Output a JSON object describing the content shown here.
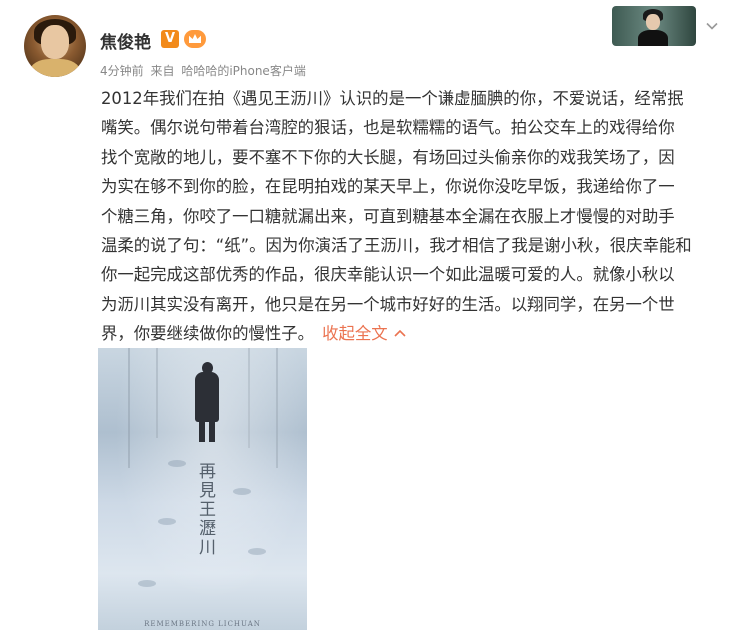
{
  "post": {
    "author": "焦俊艳",
    "vip_badge": "V",
    "time": "4分钟前",
    "source_prefix": "来自",
    "source": "哈哈哈的iPhone客户端",
    "lines": [
      "2012年我们在拍《遇见王沥川》认识的是一个谦虚腼腆的你，不爱说话，经常抿",
      "嘴笑。偶尔说句带着台湾腔的狠话，也是软糯糯的语气。拍公交车上的戏得给你",
      "找个宽敞的地儿，要不塞不下你的大长腿，有场回过头偷亲你的戏我笑场了，因",
      "为实在够不到你的脸，在昆明拍戏的某天早上，你说你没吃早饭，我递给你了一",
      "个糖三角，你咬了一口糖就漏出来，可直到糖基本全漏在衣服上才慢慢的对助手",
      "温柔的说了句：“纸”。因为你演活了王沥川，我才相信了我是谢小秋，很庆幸能和",
      "你一起完成这部优秀的作品，很庆幸能认识一个如此温暖可爱的人。就像小秋以",
      "为沥川其实没有离开，他只是在另一个城市好好的生活。以翔同学，在另一个世"
    ],
    "last_line": "界，你要继续做你的慢性子。",
    "collapse_label": "收起全文",
    "collapse_icon": "chevron-up-icon"
  },
  "poster": {
    "title": "再見王瀝川",
    "subtitle": "REMEMBERING LICHUAN"
  },
  "colors": {
    "link": "#eb7350",
    "vip": "#f28a1a",
    "meta_text": "#888888"
  }
}
